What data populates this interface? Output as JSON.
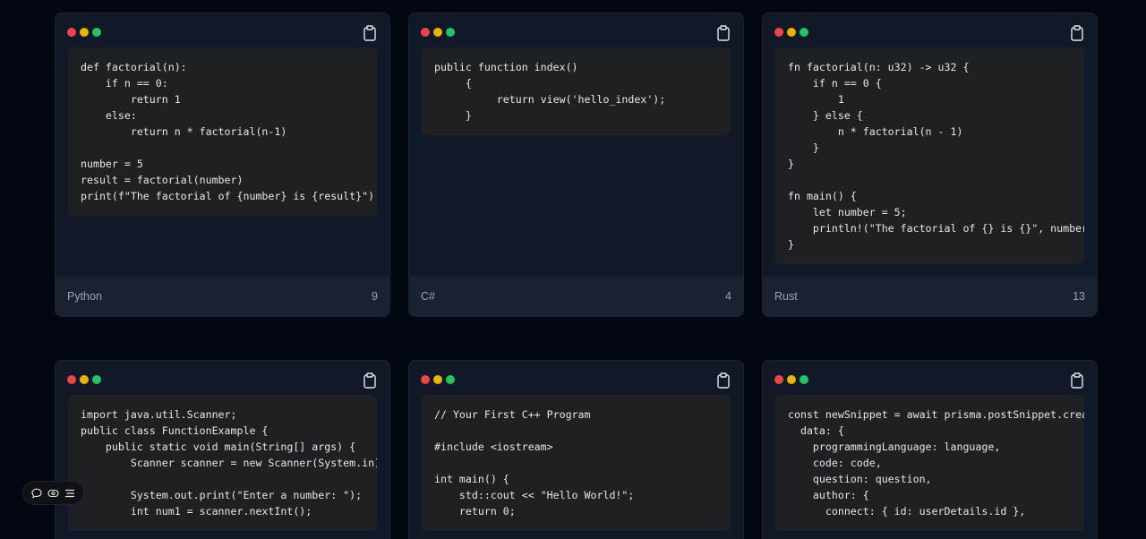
{
  "snippets": [
    {
      "language": "Python",
      "count": "9",
      "code": "def factorial(n):\n    if n == 0:\n        return 1\n    else:\n        return n * factorial(n-1)\n\nnumber = 5\nresult = factorial(number)\nprint(f\"The factorial of {number} is {result}\")"
    },
    {
      "language": "C#",
      "count": "4",
      "code": "public function index()\n     {\n          return view('hello_index');\n     }"
    },
    {
      "language": "Rust",
      "count": "13",
      "code": "fn factorial(n: u32) -> u32 {\n    if n == 0 {\n        1\n    } else {\n        n * factorial(n - 1)\n    }\n}\n\nfn main() {\n    let number = 5;\n    println!(\"The factorial of {} is {}\", number, factorial(number));\n}"
    },
    {
      "language": "",
      "count": "",
      "code": "import java.util.Scanner;\npublic class FunctionExample {\n    public static void main(String[] args) {\n        Scanner scanner = new Scanner(System.in);\n\n        System.out.print(\"Enter a number: \");\n        int num1 = scanner.nextInt();"
    },
    {
      "language": "",
      "count": "",
      "code": "// Your First C++ Program\n\n#include <iostream>\n\nint main() {\n    std::cout << \"Hello World!\";\n    return 0;"
    },
    {
      "language": "",
      "count": "",
      "code": "const newSnippet = await prisma.postSnippet.create({\n  data: {\n    programmingLanguage: language,\n    code: code,\n    question: question,\n    author: {\n      connect: { id: userDetails.id },"
    }
  ],
  "colors": {
    "page_bg": "#030712",
    "card_bg": "#111827",
    "code_bg": "#1f2024",
    "footer_bg": "#1a2232",
    "dot_red": "#ef4444",
    "dot_yellow": "#eab308",
    "dot_green": "#22c55e"
  },
  "icons": {
    "copy": "clipboard-icon",
    "toolbar": [
      "comment-icon",
      "eye-icon",
      "menu-icon"
    ]
  }
}
